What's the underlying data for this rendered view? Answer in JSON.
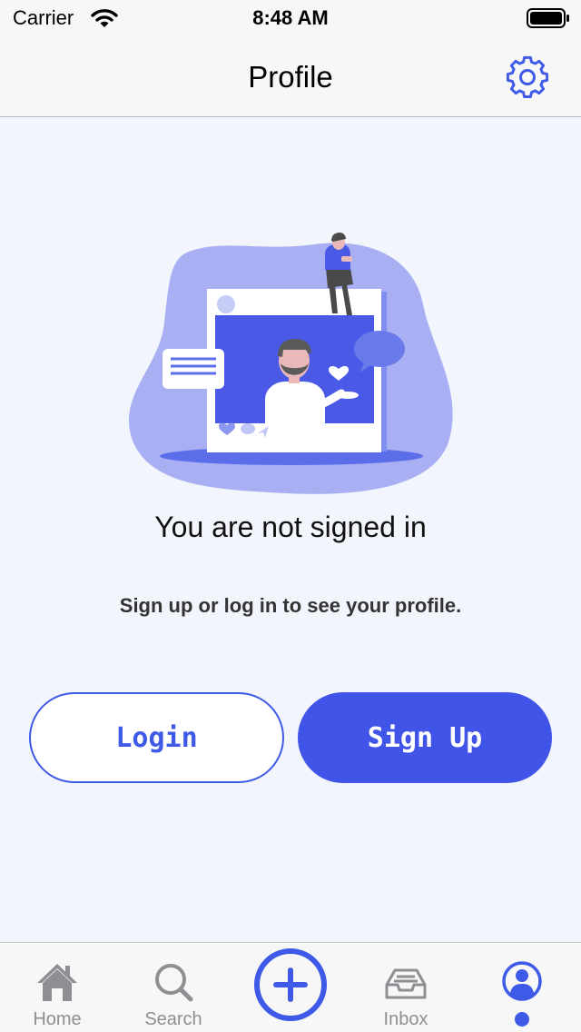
{
  "status_bar": {
    "carrier": "Carrier",
    "time": "8:48 AM"
  },
  "nav": {
    "title": "Profile",
    "settings_icon": "gear-icon"
  },
  "main": {
    "illustration": "social-profile-illustration",
    "heading": "You are not signed in",
    "subtext": "Sign up or log in to see your profile.",
    "login_label": "Login",
    "signup_label": "Sign Up"
  },
  "tab_bar": {
    "tabs": [
      {
        "label": "Home",
        "icon": "home-icon"
      },
      {
        "label": "Search",
        "icon": "search-icon"
      },
      {
        "label": "",
        "icon": "plus-icon"
      },
      {
        "label": "Inbox",
        "icon": "inbox-icon"
      },
      {
        "label": "",
        "icon": "profile-icon",
        "selected": true
      }
    ]
  },
  "colors": {
    "accent": "#4055e8",
    "tab_inactive": "#8e8e93",
    "background": "#f3f5fd"
  }
}
